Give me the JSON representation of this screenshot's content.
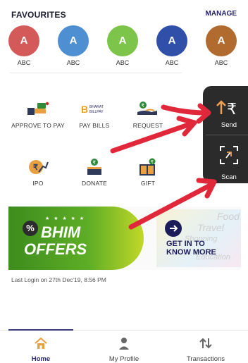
{
  "favourites": {
    "title": "FAVOURITES",
    "manage": "MANAGE",
    "items": [
      {
        "initial": "A",
        "name": "ABC",
        "color": "#d45a5a"
      },
      {
        "initial": "A",
        "name": "ABC",
        "color": "#4e8fd2"
      },
      {
        "initial": "A",
        "name": "ABC",
        "color": "#7cc54a"
      },
      {
        "initial": "A",
        "name": "ABC",
        "color": "#2f4fa8"
      },
      {
        "initial": "A",
        "name": "ABC",
        "color": "#b26b2f"
      }
    ]
  },
  "actions": [
    {
      "label": "APPROVE TO PAY",
      "icon": "approve-to-pay-icon"
    },
    {
      "label": "PAY BILLS",
      "icon": "bharat-billpay-icon",
      "icon_text": "BHARAT BILLPAY"
    },
    {
      "label": "REQUEST",
      "icon": "request-money-icon"
    },
    {
      "label": "IPO",
      "icon": "ipo-icon"
    },
    {
      "label": "DONATE",
      "icon": "donate-icon"
    },
    {
      "label": "GIFT",
      "icon": "gift-icon"
    }
  ],
  "quick": {
    "send": "Send",
    "scan": "Scan"
  },
  "banner": {
    "line1": "BHIM",
    "line2": "OFFERS",
    "stars": "★ ★ ★ ★ ★",
    "cta_line1": "GET IN TO",
    "cta_line2": "KNOW MORE",
    "bg_words": [
      "Food",
      "Travel",
      "Shopping",
      "Education"
    ]
  },
  "last_login": "Last Login on 27th Dec'19, 8:56 PM",
  "nav": {
    "home": "Home",
    "profile": "My Profile",
    "transactions": "Transactions"
  },
  "colors": {
    "accent": "#2a2a6a",
    "arrow": "#e0283a"
  }
}
